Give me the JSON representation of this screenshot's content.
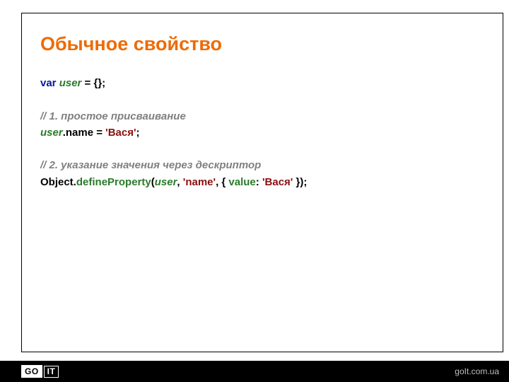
{
  "title": "Обычное свойство",
  "code": {
    "l1_var": "var ",
    "l1_ident": "user",
    "l1_rest": " = {};",
    "l3_comment": "// 1. простое присваивание",
    "l4_ident": "user",
    "l4_rest1": ".name = ",
    "l4_str": "'Вася'",
    "l4_rest2": ";",
    "l6_comment": "// 2. указание значения через дескриптор",
    "l7_obj": "Object.",
    "l7_method": "defineProperty",
    "l7_open": "(",
    "l7_arg1": "user",
    "l7_comma1": ", ",
    "l7_arg2": "'name'",
    "l7_comma2": ", { ",
    "l7_valkey": "value",
    "l7_colon": ": ",
    "l7_valstr": "'Вася'",
    "l7_close": " });"
  },
  "footer": {
    "logo_go": "GO",
    "logo_it": "IT",
    "link": "goIt.com.ua"
  }
}
